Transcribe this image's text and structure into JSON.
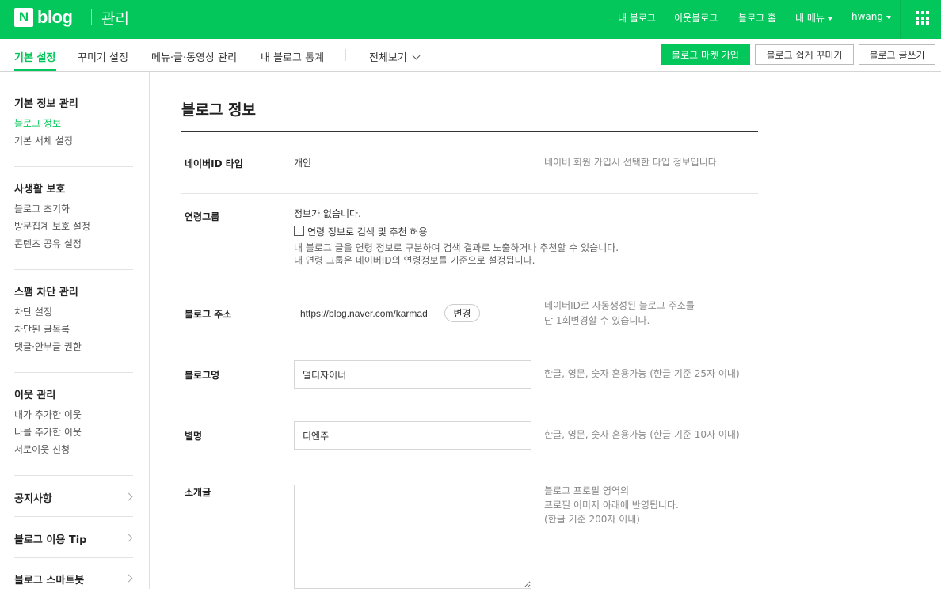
{
  "header": {
    "logo_n": "N",
    "logo_text": "blog",
    "section": "관리",
    "nav": [
      "내 블로그",
      "이웃블로그",
      "블로그 홈",
      "내 메뉴",
      "hwang"
    ]
  },
  "subnav": {
    "tabs": [
      "기본 설정",
      "꾸미기 설정",
      "메뉴·글·동영상 관리",
      "내 블로그 통계"
    ],
    "view_all": "전체보기",
    "buttons": [
      "블로그 마켓 가입",
      "블로그 쉽게 꾸미기",
      "블로그 글쓰기"
    ]
  },
  "sidebar": {
    "groups": [
      {
        "title": "기본 정보 관리",
        "items": [
          "블로그 정보",
          "기본 서체 설정"
        ]
      },
      {
        "title": "사생활 보호",
        "items": [
          "블로그 초기화",
          "방문집계 보호 설정",
          "콘텐츠 공유 설정"
        ]
      },
      {
        "title": "스팸 차단 관리",
        "items": [
          "차단 설정",
          "차단된 글목록",
          "댓글·안부글 권한"
        ]
      },
      {
        "title": "이웃 관리",
        "items": [
          "내가 추가한 이웃",
          "나를 추가한 이웃",
          "서로이웃 신청"
        ]
      }
    ],
    "links": [
      "공지사항",
      "블로그 이용 Tip",
      "블로그 스마트봇"
    ]
  },
  "main": {
    "title": "블로그 정보",
    "rows": {
      "id_type": {
        "label": "네이버ID 타입",
        "value": "개인",
        "help": "네이버 회원 가입시 선택한 타입 정보입니다."
      },
      "age": {
        "label": "연령그룹",
        "value": "정보가 없습니다.",
        "checkbox_label": "연령 정보로 검색 및 추천 허용",
        "desc1": "내 블로그 글을 연령 정보로 구분하여 검색 결과로 노출하거나 추천할 수 있습니다.",
        "desc2": "내 연령 그룹은 네이버ID의 연령정보를 기준으로 설정됩니다."
      },
      "address": {
        "label": "블로그 주소",
        "value": "https://blog.naver.com/karmad",
        "button": "변경",
        "help1": "네이버ID로 자동생성된 블로그 주소를",
        "help2": "단 1회변경할 수 있습니다."
      },
      "name": {
        "label": "블로그명",
        "value": "멀티자이너",
        "help": "한글, 영문, 숫자 혼용가능 (한글 기준 25자 이내)"
      },
      "nickname": {
        "label": "별명",
        "value": "디엔주",
        "help": "한글, 영문, 숫자 혼용가능 (한글 기준 10자 이내)"
      },
      "intro": {
        "label": "소개글",
        "value": "",
        "help1": "블로그 프로필 영역의",
        "help2": "프로필 이미지 아래에 반영됩니다.",
        "help3": "(한글 기준 200자 이내)"
      }
    }
  },
  "colors": {
    "brand": "#03c75a"
  }
}
